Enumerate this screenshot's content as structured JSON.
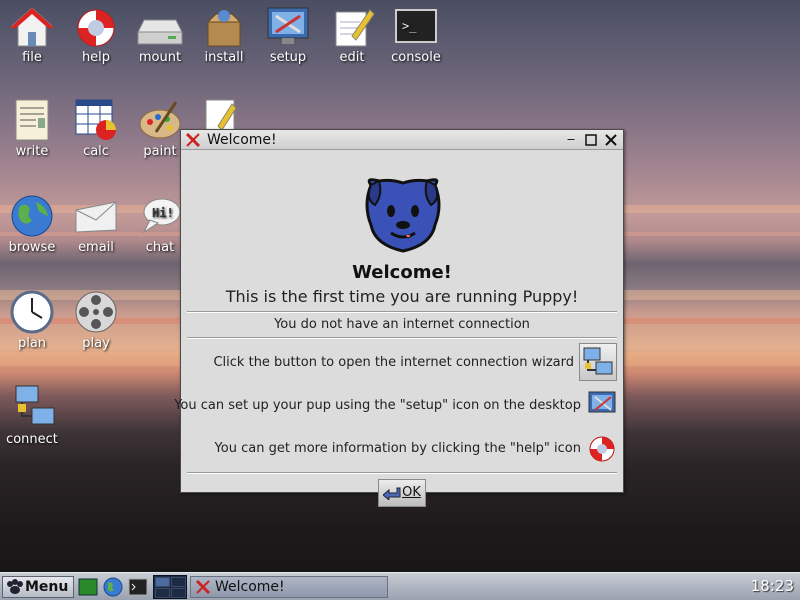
{
  "desktop": {
    "icons": [
      {
        "label": "file"
      },
      {
        "label": "help"
      },
      {
        "label": "mount"
      },
      {
        "label": "install"
      },
      {
        "label": "setup"
      },
      {
        "label": "edit"
      },
      {
        "label": "console"
      },
      {
        "label": "write"
      },
      {
        "label": "calc"
      },
      {
        "label": "paint"
      },
      {
        "label": "browse"
      },
      {
        "label": "email"
      },
      {
        "label": "chat"
      },
      {
        "label": "plan"
      },
      {
        "label": "play"
      },
      {
        "label": "connect"
      }
    ]
  },
  "window": {
    "title": "Welcome!",
    "heading": "Welcome!",
    "subheading": "This is the first time you are running Puppy!",
    "status": "You do not have an internet connection",
    "rows": [
      {
        "text": "Click the button to open the internet connection wizard",
        "icon": "network-connect-icon"
      },
      {
        "text": "You can set up your pup using the \"setup\" icon on the desktop",
        "icon": "setup-icon"
      },
      {
        "text": "You can get more information by clicking the \"help\" icon",
        "icon": "help-lifebuoy-icon"
      }
    ],
    "ok_label": "OK",
    "accent": "#cc2222"
  },
  "taskbar": {
    "menu_label": "Menu",
    "task_title": "Welcome!",
    "clock": "18:23"
  }
}
